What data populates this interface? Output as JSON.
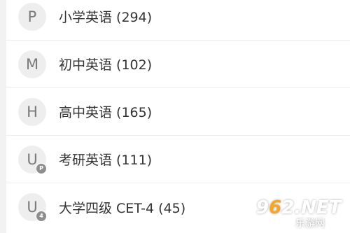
{
  "items": [
    {
      "avatar": "P",
      "badge": "",
      "label": "小学英语 (294)"
    },
    {
      "avatar": "M",
      "badge": "",
      "label": "初中英语 (102)"
    },
    {
      "avatar": "H",
      "badge": "",
      "label": "高中英语 (165)"
    },
    {
      "avatar": "U",
      "badge": "P",
      "label": "考研英语 (111)"
    },
    {
      "avatar": "U",
      "badge": "4",
      "label": "大学四级 CET-4 (45)"
    }
  ],
  "watermark": {
    "logo_part1": "9",
    "logo_part2": "6",
    "logo_part3": "2",
    "logo_part4": ".NET",
    "sub": "乐游网"
  }
}
